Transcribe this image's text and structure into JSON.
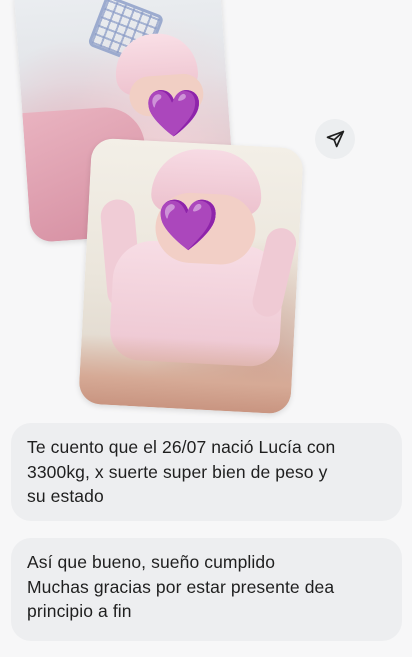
{
  "chat": {
    "photos": [
      {
        "emoji": "💜"
      },
      {
        "emoji": "💜"
      }
    ],
    "share_icon": "send-icon",
    "messages": [
      {
        "lines": [
          "Te cuento que el 26/07 nació Lucía con",
          "3300kg, x suerte super bien de peso y",
          "su estado"
        ]
      },
      {
        "lines": [
          "Así que bueno, sueño cumplido",
          "Muchas gracias por estar presente dea",
          "principio a fin"
        ]
      }
    ]
  },
  "colors": {
    "background": "#f7f7f8",
    "bubble": "#edeef0",
    "text": "#1f1f1f",
    "heart": "#a24ddf"
  }
}
